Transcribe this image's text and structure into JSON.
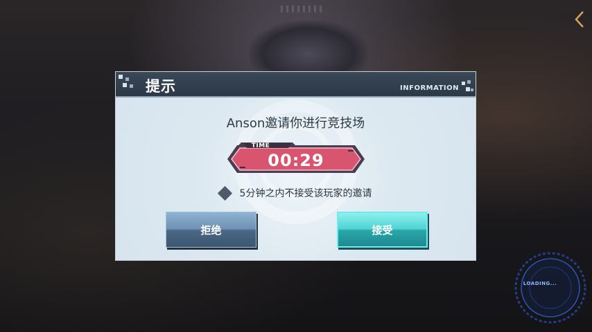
{
  "dialog": {
    "title": "提示",
    "header_tag": "INFORMATION",
    "message": "Anson邀请你进行竞技场",
    "timer": {
      "label": "TIME",
      "value": "00:29"
    },
    "notice": "5分钟之内不接受该玩家的邀请",
    "buttons": {
      "reject": "拒绝",
      "accept": "接受"
    }
  },
  "loading": {
    "label": "LOADING..."
  },
  "icons": {
    "back": "chevron-left-icon",
    "notice": "diamond-icon"
  },
  "colors": {
    "timer_fill": "#d9546f",
    "accept_button": "#4fd3d3",
    "reject_button": "#6e91b3",
    "header": "#2c3846",
    "back_icon": "#d9a25a"
  }
}
